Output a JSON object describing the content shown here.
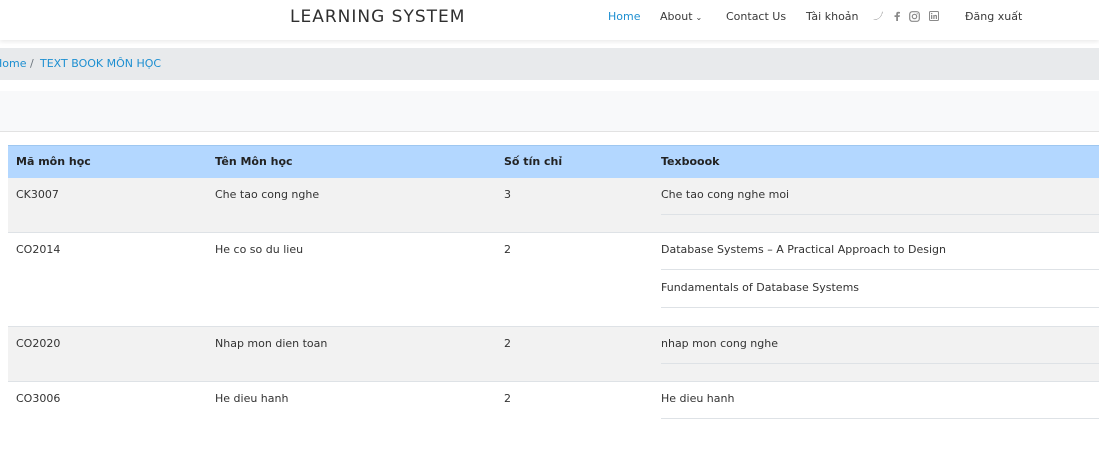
{
  "header": {
    "brand": "LEARNING SYSTEM",
    "nav": {
      "home": "Home",
      "about": "About",
      "contact": "Contact Us",
      "account": "Tài khoản",
      "logout": "Đăng xuất"
    },
    "social_icons": [
      "twitter-icon",
      "facebook-icon",
      "instagram-icon",
      "linkedin-icon"
    ]
  },
  "breadcrumb": {
    "home": "Home",
    "separator": "/",
    "current": "TEXT BOOK MÔN HỌC"
  },
  "table": {
    "headers": [
      "Mã môn học",
      "Tên Môn học",
      "Số tín chỉ",
      "Texboook"
    ],
    "rows": [
      {
        "code": "CK3007",
        "name": "Che tao cong nghe",
        "credits": "3",
        "textbooks": [
          "Che tao cong nghe moi"
        ]
      },
      {
        "code": "CO2014",
        "name": "He co so du lieu",
        "credits": "2",
        "textbooks": [
          "Database Systems – A Practical Approach to Design",
          "Fundamentals of Database Systems"
        ]
      },
      {
        "code": "CO2020",
        "name": "Nhap mon dien toan",
        "credits": "2",
        "textbooks": [
          "nhap mon cong nghe"
        ]
      },
      {
        "code": "CO3006",
        "name": "He dieu hanh",
        "credits": "2",
        "textbooks": [
          "He dieu hanh"
        ]
      }
    ]
  },
  "colors": {
    "accent": "#1d8fd1",
    "table_header_bg": "#b3d7ff",
    "row_stripe": "#f2f2f2",
    "breadcrumb_bg": "#e8eaec"
  }
}
